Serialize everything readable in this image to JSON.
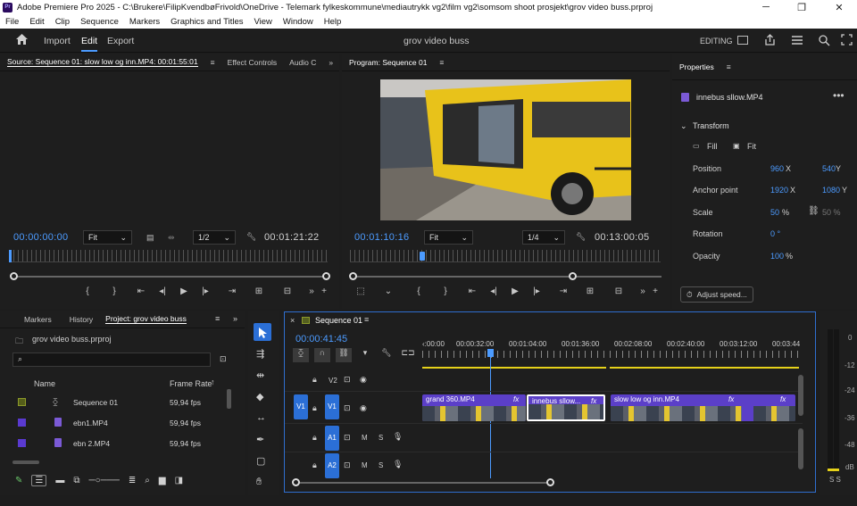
{
  "titlebar": {
    "app_title": "Adobe Premiere Pro 2025 - C:\\Brukere\\FilipKvendbøFrivold\\OneDrive - Telemark fylkeskommune\\mediautrykk vg2\\film vg2\\somsom shoot prosjekt\\grov video buss.prproj",
    "logo_text": "Pr",
    "minimize": "─",
    "maximize": "❐",
    "close": "✕"
  },
  "menubar": {
    "items": [
      "File",
      "Edit",
      "Clip",
      "Sequence",
      "Markers",
      "Graphics and Titles",
      "View",
      "Window",
      "Help"
    ]
  },
  "workspace": {
    "home_icon": "home-icon",
    "import": "Import",
    "edit": "Edit",
    "export": "Export",
    "project_title": "grov video buss",
    "workspace_label": "EDITING"
  },
  "source": {
    "tab_source": "Source: Sequence 01: slow low og inn.MP4: 00:01:55:01",
    "tab_effect": "Effect Controls",
    "tab_audio": "Audio C",
    "timecode_in": "00:00:00:00",
    "fit": "Fit",
    "resolution": "1/2",
    "duration": "00:01:21:22"
  },
  "program": {
    "tab": "Program: Sequence 01",
    "timecode": "00:01:10:16",
    "fit": "Fit",
    "resolution": "1/4",
    "duration": "00:13:00:05"
  },
  "properties": {
    "tab": "Properties",
    "clip_name": "innebus sllow.MP4",
    "section": "Transform",
    "fill": "Fill",
    "fit": "Fit",
    "position_label": "Position",
    "position_x": "960",
    "position_y": "540",
    "anchor_label": "Anchor point",
    "anchor_x": "1920",
    "anchor_y": "1080",
    "scale_label": "Scale",
    "scale_value": "50",
    "scale_unit": "%",
    "scale_linked": "50 %",
    "rotation_label": "Rotation",
    "rotation_value": "0 °",
    "opacity_label": "Opacity",
    "opacity_value": "100",
    "opacity_unit": "%",
    "x": "X",
    "y": "Y",
    "adjust_speed": "Adjust speed..."
  },
  "project": {
    "tab_markers": "Markers",
    "tab_history": "History",
    "tab_project": "Project: grov video buss",
    "file_name": "grov video buss.prproj",
    "col_name": "Name",
    "col_framerate": "Frame Rate",
    "items": [
      {
        "name": "Sequence 01",
        "rate": "59,94 fps",
        "color": "#6b7a2a"
      },
      {
        "name": "ebn1.MP4",
        "rate": "59,94 fps",
        "color": "#5a3ad0"
      },
      {
        "name": "ebn 2.MP4",
        "rate": "59,94 fps",
        "color": "#5a3ad0"
      }
    ]
  },
  "timeline": {
    "tab": "Sequence 01",
    "timecode": "00:00:41:45",
    "ruler": [
      "‹:00:00",
      "00:00:32:00",
      "00:01:04:00",
      "00:01:36:00",
      "00:02:08:00",
      "00:02:40:00",
      "00:03:12:00",
      "00:03:44"
    ],
    "tracks": {
      "v2": "V2",
      "v1": "V1",
      "a1": "A1",
      "a2": "A2"
    },
    "m": "M",
    "s": "S",
    "clips": [
      {
        "name": "grand 360.MP4"
      },
      {
        "name": "innebus sllow..."
      },
      {
        "name": "slow low og inn.MP4"
      }
    ],
    "fx": "fx"
  },
  "meter": {
    "labels": [
      "0",
      "-12",
      "-24",
      "-36",
      "-48",
      "dB"
    ],
    "solo": "S  S"
  },
  "colors": {
    "accent": "#4c9bff",
    "clip_purple": "#5b3fc8",
    "yellow_bar": "#e6d21a"
  }
}
